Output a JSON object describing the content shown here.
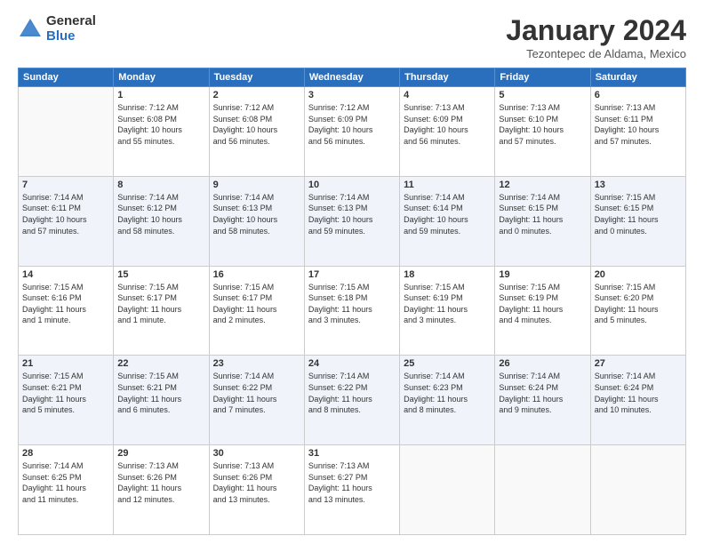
{
  "logo": {
    "general": "General",
    "blue": "Blue"
  },
  "header": {
    "month": "January 2024",
    "location": "Tezontepec de Aldama, Mexico"
  },
  "days_of_week": [
    "Sunday",
    "Monday",
    "Tuesday",
    "Wednesday",
    "Thursday",
    "Friday",
    "Saturday"
  ],
  "weeks": [
    [
      {
        "day": "",
        "info": ""
      },
      {
        "day": "1",
        "info": "Sunrise: 7:12 AM\nSunset: 6:08 PM\nDaylight: 10 hours\nand 55 minutes."
      },
      {
        "day": "2",
        "info": "Sunrise: 7:12 AM\nSunset: 6:08 PM\nDaylight: 10 hours\nand 56 minutes."
      },
      {
        "day": "3",
        "info": "Sunrise: 7:12 AM\nSunset: 6:09 PM\nDaylight: 10 hours\nand 56 minutes."
      },
      {
        "day": "4",
        "info": "Sunrise: 7:13 AM\nSunset: 6:09 PM\nDaylight: 10 hours\nand 56 minutes."
      },
      {
        "day": "5",
        "info": "Sunrise: 7:13 AM\nSunset: 6:10 PM\nDaylight: 10 hours\nand 57 minutes."
      },
      {
        "day": "6",
        "info": "Sunrise: 7:13 AM\nSunset: 6:11 PM\nDaylight: 10 hours\nand 57 minutes."
      }
    ],
    [
      {
        "day": "7",
        "info": "Sunrise: 7:14 AM\nSunset: 6:11 PM\nDaylight: 10 hours\nand 57 minutes."
      },
      {
        "day": "8",
        "info": "Sunrise: 7:14 AM\nSunset: 6:12 PM\nDaylight: 10 hours\nand 58 minutes."
      },
      {
        "day": "9",
        "info": "Sunrise: 7:14 AM\nSunset: 6:13 PM\nDaylight: 10 hours\nand 58 minutes."
      },
      {
        "day": "10",
        "info": "Sunrise: 7:14 AM\nSunset: 6:13 PM\nDaylight: 10 hours\nand 59 minutes."
      },
      {
        "day": "11",
        "info": "Sunrise: 7:14 AM\nSunset: 6:14 PM\nDaylight: 10 hours\nand 59 minutes."
      },
      {
        "day": "12",
        "info": "Sunrise: 7:14 AM\nSunset: 6:15 PM\nDaylight: 11 hours\nand 0 minutes."
      },
      {
        "day": "13",
        "info": "Sunrise: 7:15 AM\nSunset: 6:15 PM\nDaylight: 11 hours\nand 0 minutes."
      }
    ],
    [
      {
        "day": "14",
        "info": "Sunrise: 7:15 AM\nSunset: 6:16 PM\nDaylight: 11 hours\nand 1 minute."
      },
      {
        "day": "15",
        "info": "Sunrise: 7:15 AM\nSunset: 6:17 PM\nDaylight: 11 hours\nand 1 minute."
      },
      {
        "day": "16",
        "info": "Sunrise: 7:15 AM\nSunset: 6:17 PM\nDaylight: 11 hours\nand 2 minutes."
      },
      {
        "day": "17",
        "info": "Sunrise: 7:15 AM\nSunset: 6:18 PM\nDaylight: 11 hours\nand 3 minutes."
      },
      {
        "day": "18",
        "info": "Sunrise: 7:15 AM\nSunset: 6:19 PM\nDaylight: 11 hours\nand 3 minutes."
      },
      {
        "day": "19",
        "info": "Sunrise: 7:15 AM\nSunset: 6:19 PM\nDaylight: 11 hours\nand 4 minutes."
      },
      {
        "day": "20",
        "info": "Sunrise: 7:15 AM\nSunset: 6:20 PM\nDaylight: 11 hours\nand 5 minutes."
      }
    ],
    [
      {
        "day": "21",
        "info": "Sunrise: 7:15 AM\nSunset: 6:21 PM\nDaylight: 11 hours\nand 5 minutes."
      },
      {
        "day": "22",
        "info": "Sunrise: 7:15 AM\nSunset: 6:21 PM\nDaylight: 11 hours\nand 6 minutes."
      },
      {
        "day": "23",
        "info": "Sunrise: 7:14 AM\nSunset: 6:22 PM\nDaylight: 11 hours\nand 7 minutes."
      },
      {
        "day": "24",
        "info": "Sunrise: 7:14 AM\nSunset: 6:22 PM\nDaylight: 11 hours\nand 8 minutes."
      },
      {
        "day": "25",
        "info": "Sunrise: 7:14 AM\nSunset: 6:23 PM\nDaylight: 11 hours\nand 8 minutes."
      },
      {
        "day": "26",
        "info": "Sunrise: 7:14 AM\nSunset: 6:24 PM\nDaylight: 11 hours\nand 9 minutes."
      },
      {
        "day": "27",
        "info": "Sunrise: 7:14 AM\nSunset: 6:24 PM\nDaylight: 11 hours\nand 10 minutes."
      }
    ],
    [
      {
        "day": "28",
        "info": "Sunrise: 7:14 AM\nSunset: 6:25 PM\nDaylight: 11 hours\nand 11 minutes."
      },
      {
        "day": "29",
        "info": "Sunrise: 7:13 AM\nSunset: 6:26 PM\nDaylight: 11 hours\nand 12 minutes."
      },
      {
        "day": "30",
        "info": "Sunrise: 7:13 AM\nSunset: 6:26 PM\nDaylight: 11 hours\nand 13 minutes."
      },
      {
        "day": "31",
        "info": "Sunrise: 7:13 AM\nSunset: 6:27 PM\nDaylight: 11 hours\nand 13 minutes."
      },
      {
        "day": "",
        "info": ""
      },
      {
        "day": "",
        "info": ""
      },
      {
        "day": "",
        "info": ""
      }
    ]
  ]
}
